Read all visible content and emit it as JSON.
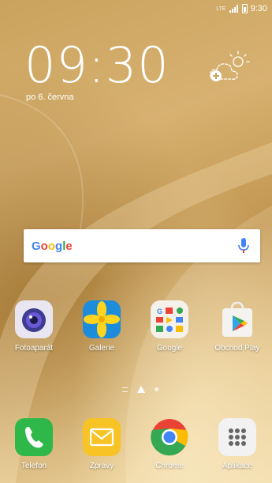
{
  "status_bar": {
    "network": "LTE",
    "time": "9:30"
  },
  "lockscreen_widget": {
    "time": "09:30",
    "date": "po 6. června"
  },
  "weather_widget": {
    "icon": "weather-add-icon"
  },
  "search_bar": {
    "logo": "Google",
    "mic_icon": "mic-icon"
  },
  "home_apps": [
    {
      "label": "Fotoaparát",
      "icon": "camera-icon"
    },
    {
      "label": "Galerie",
      "icon": "gallery-icon"
    },
    {
      "label": "Google",
      "icon": "google-folder-icon"
    },
    {
      "label": "Obchod Play",
      "icon": "play-store-icon"
    }
  ],
  "page_indicator": {
    "pages": 3,
    "current": 2
  },
  "dock_apps": [
    {
      "label": "Telefon",
      "icon": "phone-icon"
    },
    {
      "label": "Zprávy",
      "icon": "messages-icon"
    },
    {
      "label": "Chrome",
      "icon": "chrome-icon"
    },
    {
      "label": "Aplikace",
      "icon": "apps-grid-icon"
    }
  ],
  "colors": {
    "google_blue": "#4285F4",
    "google_red": "#EA4335",
    "google_yellow": "#FBBC05",
    "google_green": "#34A853",
    "phone_green": "#2fb84a",
    "messages_yellow": "#f7c325"
  }
}
